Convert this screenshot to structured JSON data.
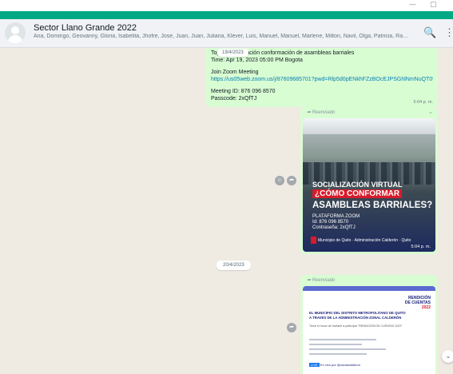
{
  "window": {
    "minimize": "—",
    "restore": "▢"
  },
  "header": {
    "title": "Sector Llano Grande 2022",
    "members": "Ana, Domingo, Geovanny, Gloria, Isabelita, Jhofre, Jose, Juan, Juan, Juliana, Klever, Luis, Manuel, Manuel, Marlene, Milton, Navil, Olga, Patricia, Rafael, Raquel, R...",
    "search_icon": "🔍",
    "menu_icon": "⋮"
  },
  "messages": {
    "text": {
      "line1": "Topic: Socialización conformación de asambleas barriales",
      "line2": "Time: Apr 19, 2023 05:00 PM Bogota",
      "join": "Join Zoom Meeting",
      "link": "https://us05web.zoom.us/j/87609685701?pwd=Rlp5d0pENkhFZzBOcEJPSGhlNmNuQT09",
      "meeting_id": "Meeting ID: 876 096 8570",
      "passcode": "Passcode: 2xQfTJ",
      "time": "5:04 p. m."
    },
    "date_floating": "19/4/2023",
    "image1": {
      "forwarded": "Reenviado",
      "tag": "SOCIALIZACIÓN VIRTUAL",
      "line1": "SOCIALIZACIÓN VIRTUAL",
      "line2": "¿CÓMO CONFORMAR",
      "line3": "ASAMBLEAS BARRIALES?",
      "line4a": "PLATAFORMA ZOOM",
      "line4b": "Id: 876 096 8570",
      "line4c": "Contraseña: 2xQfTJ",
      "logos": "Municipio de Quito · Administración Calderón · Quito",
      "time": "5:04 p. m."
    },
    "date_chip": "20/4/2023",
    "image2": {
      "forwarded": "Reenviado",
      "hdr1": "RENDICIÓN",
      "hdr2": "DE CUENTAS",
      "hdr3": "2022",
      "title1": "EL MUNICIPIO DEL DISTRITO METROPOLITANO DE QUITO",
      "title2": "A TRAVÉS DE LA ADMINISTRACIÓN ZONAL CALDERÓN",
      "subtitle": "Tiene el honor de invitarle a participar \"RENDICIÓN DE CUENTAS 2022\"",
      "live": "LIVE",
      "live_text": "En vivo por @zonalcalderon"
    }
  }
}
